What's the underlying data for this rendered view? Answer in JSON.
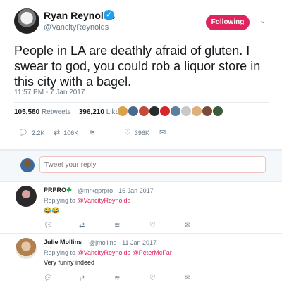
{
  "tweet": {
    "author_name": "Ryan Reynolds",
    "author_handle": "@VancityReynolds",
    "follow_label": "Following",
    "text": "People in LA are deathly afraid of gluten. I swear to god, you could rob a liquor store in this city with a bagel.",
    "timestamp": "11:57 PM - 7 Jan 2017",
    "retweets_count": "105,580",
    "retweets_label": "Retweets",
    "likes_count": "396,210",
    "likes_label": "Likes",
    "liker_avatar_colors": [
      "#d9a14a",
      "#4a6b8c",
      "#c24b3a",
      "#2b2b2b",
      "#d7262b",
      "#5c7f9a",
      "#c9c9c9",
      "#e0b07a",
      "#7a4b3a",
      "#3d5a3d"
    ],
    "actions": {
      "reply_count": "2.2K",
      "retweet_count": "106K",
      "like_count": "396K"
    }
  },
  "composer": {
    "placeholder": "Tweet your reply"
  },
  "replies": [
    {
      "name": "PRPRO",
      "badge": "☘",
      "handle": "@mrkgprpro",
      "date": "16 Jan 2017",
      "replying_prefix": "Replying to",
      "mentions": "@VancityReynolds",
      "body": "😂😂"
    },
    {
      "name": "Julie Mollins",
      "handle": "@jmollins",
      "date": "11 Jan 2017",
      "replying_prefix": "Replying to",
      "mentions": "@VancityReynolds @PeterMcFar",
      "body": "Very funny indeed"
    }
  ],
  "colors": {
    "accent": "#e0245e",
    "link_blue": "#1da1f2",
    "muted": "#657786"
  }
}
